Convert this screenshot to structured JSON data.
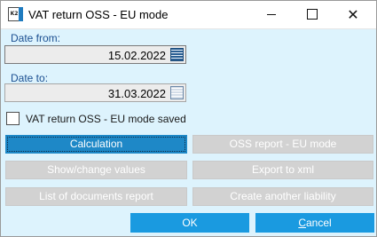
{
  "window": {
    "icon_text": "K2",
    "title": "VAT return OSS - EU mode"
  },
  "form": {
    "date_from_label": "Date from:",
    "date_from_value": "15.02.2022",
    "date_to_label": "Date to:",
    "date_to_value": "31.03.2022",
    "saved_checkbox_label": "VAT return OSS - EU mode saved",
    "saved_checked": false
  },
  "actions": {
    "calculation": "Calculation",
    "oss_report": "OSS report - EU mode",
    "show_change_values": "Show/change values",
    "export_xml": "Export to xml",
    "list_documents_report": "List of documents report",
    "create_liability": "Create another liability"
  },
  "footer": {
    "ok": "OK",
    "cancel_first": "C",
    "cancel_rest": "ancel"
  },
  "colors": {
    "dialog_bg": "#ddf3fd",
    "primary": "#1e88c7",
    "footer_button": "#1a9ae0",
    "disabled_button": "#d2d2d2",
    "label_text": "#1b4f91"
  }
}
